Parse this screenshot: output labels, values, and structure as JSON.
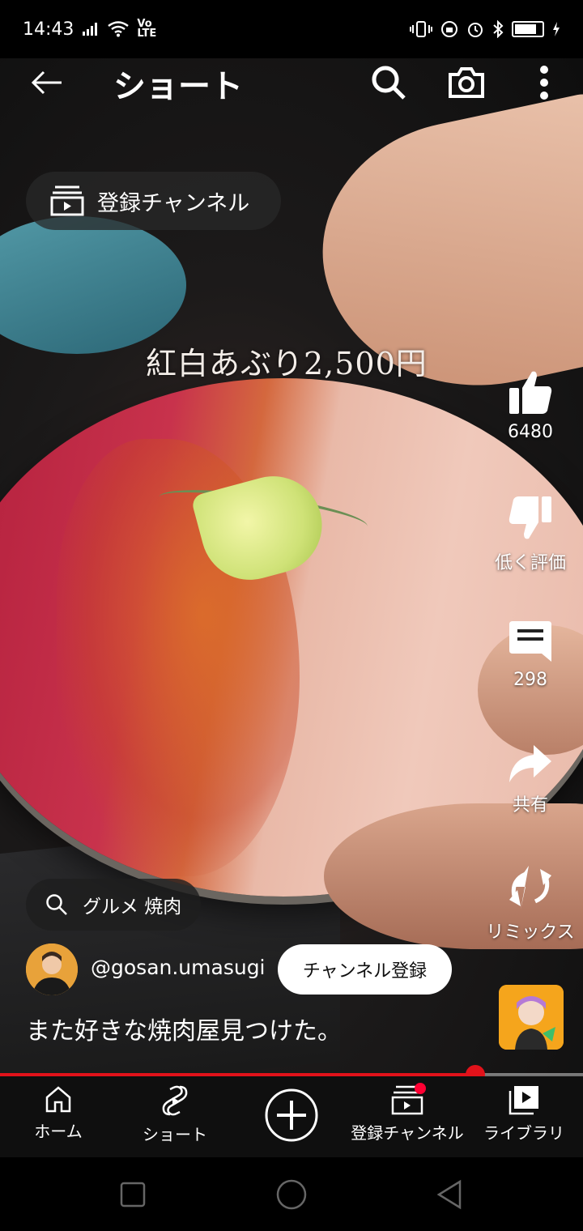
{
  "status_bar": {
    "time": "14:43",
    "network_label": "Vo LTE",
    "icons_left": [
      "signal-icon",
      "wifi-icon",
      "volte-icon"
    ],
    "icons_right": [
      "vibrate-icon",
      "dnd-icon",
      "alarm-icon",
      "bluetooth-icon",
      "battery-icon"
    ]
  },
  "top_bar": {
    "title": "ショート"
  },
  "subscriptions_chip": {
    "label": "登録チャンネル"
  },
  "video": {
    "caption_overlay": "紅白あぶり2,500円"
  },
  "actions": {
    "like_count": "6480",
    "dislike_label": "低く評価",
    "comment_count": "298",
    "share_label": "共有",
    "remix_label": "リミックス"
  },
  "search_chip": {
    "label": "グルメ 焼肉"
  },
  "channel": {
    "handle": "@gosan.umasugi",
    "subscribe_label": "チャンネル登録"
  },
  "video_title": "また好きな焼肉屋見つけた。",
  "progress": {
    "fraction": 0.815
  },
  "bottom_nav": {
    "items": [
      {
        "label": "ホーム",
        "icon": "home-icon"
      },
      {
        "label": "ショート",
        "icon": "shorts-icon"
      },
      {
        "label": "",
        "icon": "create-icon"
      },
      {
        "label": "登録チャンネル",
        "icon": "subscriptions-icon",
        "badge": true
      },
      {
        "label": "ライブラリ",
        "icon": "library-icon"
      }
    ]
  },
  "colors": {
    "accent_red": "#e1121a",
    "badge_red": "#ff0033",
    "nav_bg": "#0f0f0f",
    "subscribe_bg": "#ffffff"
  }
}
